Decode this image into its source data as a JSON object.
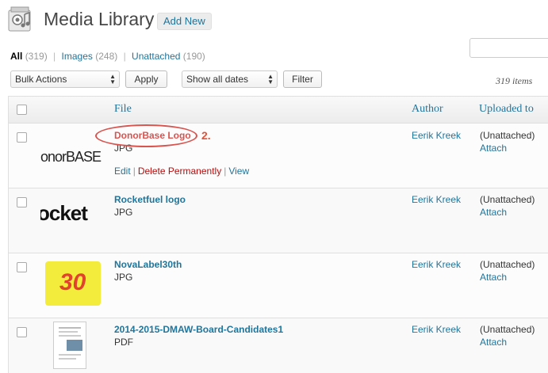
{
  "header": {
    "title": "Media Library",
    "add_new_label": "Add New"
  },
  "filters": {
    "all": {
      "label": "All",
      "count": "(319)"
    },
    "images": {
      "label": "Images",
      "count": "(248)"
    },
    "unattached": {
      "label": "Unattached",
      "count": "(190)"
    },
    "separator": "|"
  },
  "toolbar": {
    "bulk_actions": "Bulk Actions",
    "apply_label": "Apply",
    "dates": "Show all dates",
    "filter_label": "Filter",
    "items_count": "319 items"
  },
  "table": {
    "columns": {
      "file": "File",
      "author": "Author",
      "uploaded_to": "Uploaded to"
    },
    "rows": [
      {
        "name": "DonorBase Logo",
        "type": "JPG",
        "author": "Eerik Kreek",
        "uploaded": "(Unattached)",
        "attach": "Attach",
        "thumb_text": "onorBASE"
      },
      {
        "name": "Rocketfuel logo",
        "type": "JPG",
        "author": "Eerik Kreek",
        "uploaded": "(Unattached)",
        "attach": "Attach",
        "thumb_text": "ocket"
      },
      {
        "name": "NovaLabel30th",
        "type": "JPG",
        "author": "Eerik Kreek",
        "uploaded": "(Unattached)",
        "attach": "Attach",
        "thumb_text": "30"
      },
      {
        "name": "2014-2015-DMAW-Board-Candidates1",
        "type": "PDF",
        "author": "Eerik Kreek",
        "uploaded": "(Unattached)",
        "attach": "Attach"
      }
    ],
    "row_actions": {
      "edit": "Edit",
      "delete": "Delete Permanently",
      "view": "View",
      "separator": "|"
    }
  },
  "annotation": {
    "label": "2."
  },
  "colors": {
    "link": "#21759b",
    "delete": "#bc0b0b",
    "annotation": "#e0533a"
  }
}
